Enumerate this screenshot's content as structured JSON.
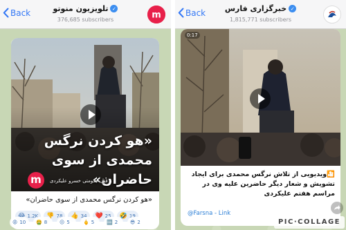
{
  "left": {
    "back_label": "Back",
    "title": "تلویزیون منوتو",
    "subscribers": "376,685 subscribers",
    "overlay_text": "«هو کردن نرگس محمدی از سوی حاضران»",
    "logo_letter": "m",
    "credit": "قتل حکومتی خسرو علیکردی",
    "caption": "«هو کردن نرگس محمدی از سوی حاضران»",
    "reactions": [
      {
        "emoji": "😂",
        "count": "1.2K"
      },
      {
        "emoji": "👎",
        "count": "78"
      },
      {
        "emoji": "👍",
        "count": "34"
      },
      {
        "emoji": "❤️",
        "count": "25"
      },
      {
        "emoji": "🤣",
        "count": "19"
      }
    ],
    "reactions_row2": [
      {
        "emoji": "😡",
        "count": "10"
      },
      {
        "emoji": "🤮",
        "count": "8"
      },
      {
        "emoji": "😐",
        "count": "5"
      },
      {
        "emoji": "🖕",
        "count": "5"
      },
      {
        "emoji": "🆒",
        "count": "2"
      },
      {
        "emoji": "😎",
        "count": "2"
      }
    ]
  },
  "right": {
    "back_label": "Back",
    "title": "خبرگزاری فارس",
    "subscribers": "1,815,771 subscribers",
    "video_time": "0:17",
    "message": "🎦ویدیویی از تلاش نرگس محمدی برای ایجاد تشویش و شعار دیگر حاضرین علیه وی در مراسم هفتم علیکردی",
    "signature": "@Farsna - Link"
  },
  "watermark": "PIC·COLLAGE",
  "colors": {
    "accent": "#3478f6",
    "logo_red": "#e8204a",
    "chat_bg": "#c8d7b5"
  }
}
